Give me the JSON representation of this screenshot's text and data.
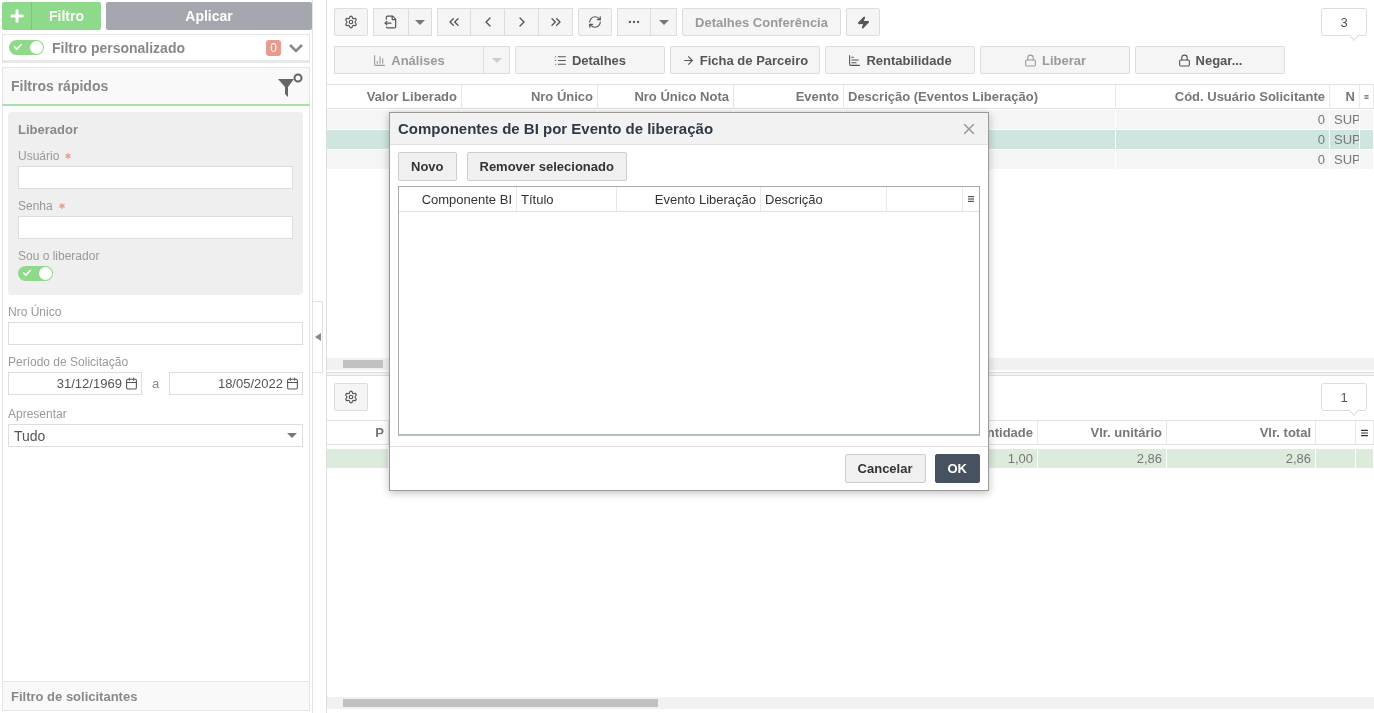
{
  "sidebar": {
    "filter_button": "Filtro",
    "apply_button": "Aplicar",
    "custom_filter": {
      "label": "Filtro personalizado",
      "on": true,
      "count": "0"
    },
    "quick_filters": {
      "title": "Filtros rápidos",
      "liberador": {
        "title": "Liberador",
        "fields": [
          {
            "label": "Usuário",
            "required": true
          },
          {
            "label": "Senha",
            "required": true
          }
        ],
        "toggle": {
          "label": "Sou o liberador",
          "on": true
        }
      },
      "nro_unico": {
        "label": "Nro Único"
      },
      "period": {
        "label": "Período de Solicitação",
        "from": "31/12/1969",
        "separator": "a",
        "to": "18/05/2022"
      },
      "apresentar": {
        "label": "Apresentar",
        "value": "Tudo"
      }
    },
    "footer": "Filtro de solicitantes"
  },
  "toolbar": {
    "conference_button": {
      "label": "Detalhes Conferência",
      "disabled": true
    },
    "page_count": "3"
  },
  "actions": [
    {
      "label": "Análises",
      "disabled": true
    },
    {
      "label": "Detalhes",
      "disabled": false
    },
    {
      "label": "Ficha de Parceiro",
      "disabled": false
    },
    {
      "label": "Rentabilidade",
      "disabled": false
    },
    {
      "label": "Liberar",
      "disabled": true
    },
    {
      "label": "Negar...",
      "disabled": false
    }
  ],
  "main_grid": {
    "columns": [
      "Valor Liberado",
      "Nro Único",
      "Nro Único Nota",
      "Evento",
      "Descrição (Eventos Liberação)",
      "Cód. Usuário Solicitante",
      "N"
    ],
    "rows": [
      {
        "selected": false,
        "cod_usuario": "0",
        "column_7": "SUP"
      },
      {
        "selected": true,
        "cod_usuario": "0",
        "column_7": "SUP"
      },
      {
        "selected": false,
        "cod_usuario": "0",
        "column_7": "SUP"
      }
    ]
  },
  "detail_toolbar": {
    "page_count": "1"
  },
  "detail_grid": {
    "columns": [
      "P",
      "ntidade",
      "Vlr. unitário",
      "Vlr. total"
    ],
    "rows": [
      {
        "selected": true,
        "cells": [
          "",
          "1,00",
          "2,86",
          "2,86"
        ]
      }
    ]
  },
  "dialog": {
    "title": "Componentes de BI por Evento de liberação",
    "buttons": [
      "Novo",
      "Remover selecionado"
    ],
    "columns": [
      "Componente BI",
      "Título",
      "Evento Liberação",
      "Descrição"
    ],
    "footer_buttons": [
      {
        "label": "Cancelar",
        "primary": false
      },
      {
        "label": "OK",
        "primary": true
      }
    ]
  }
}
